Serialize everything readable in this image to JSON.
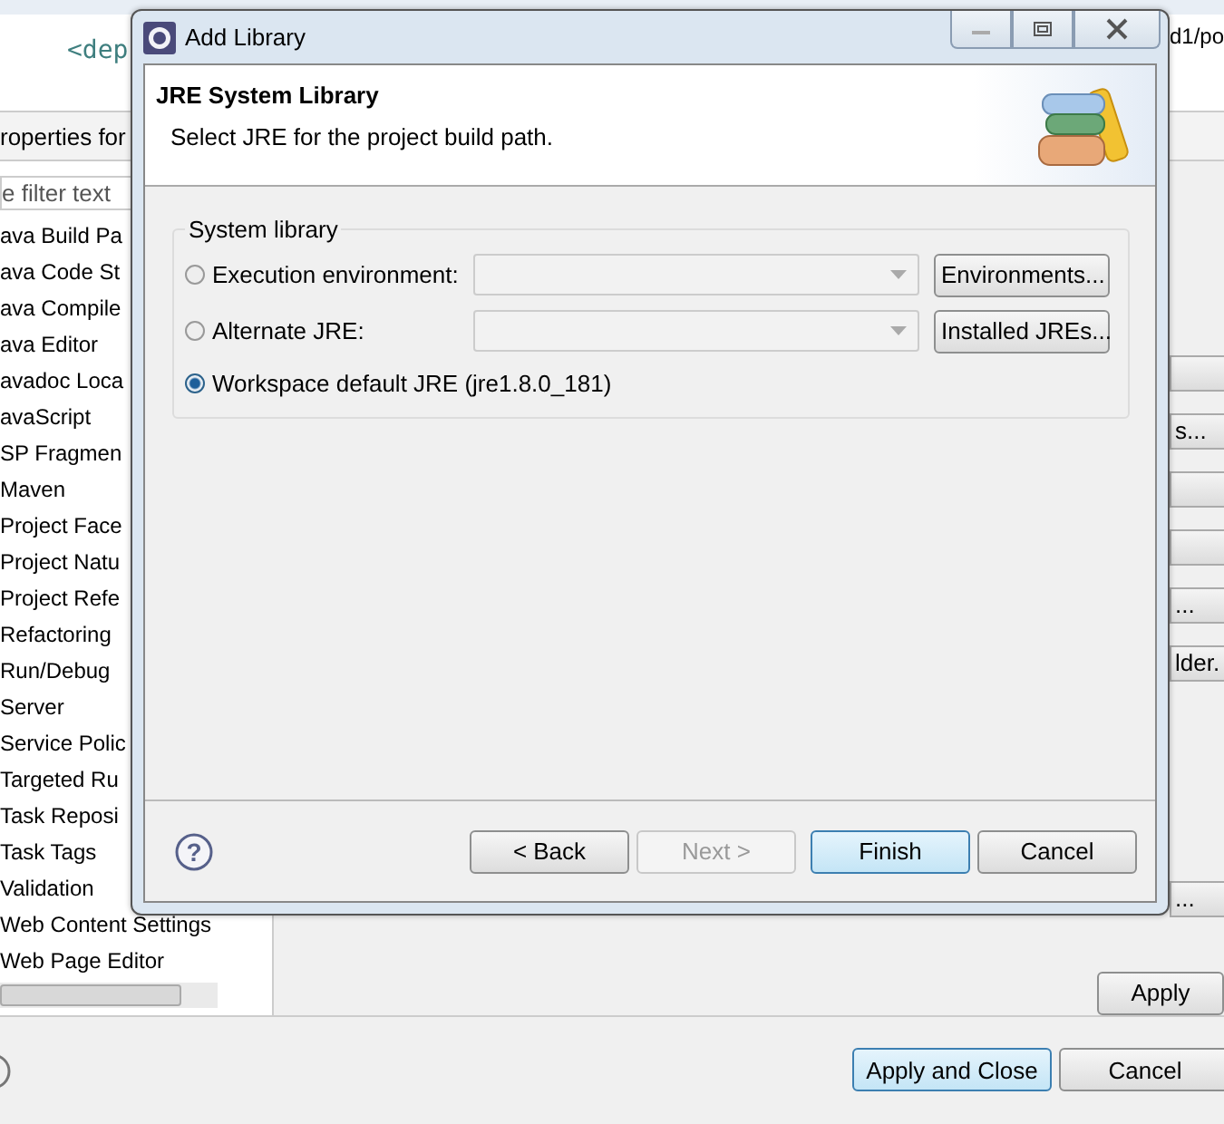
{
  "background": {
    "editor_code": "<dep",
    "editor_path": "d1/po",
    "properties_title": "roperties for",
    "filter": {
      "placeholder": "e filter text"
    },
    "tree_items": [
      "ava Build Pa",
      "ava Code St",
      "ava Compile",
      "ava Editor",
      "avadoc Loca",
      "avaScript",
      "SP Fragmen",
      "Maven",
      "Project Face",
      "Project Natu",
      "Project Refe",
      "Refactoring",
      "Run/Debug",
      "Server",
      "Service Polic",
      "Targeted Ru",
      "Task Reposi",
      "Task Tags",
      "Validation",
      "Web Content Settings",
      "Web Page Editor"
    ],
    "side_buttons": [
      {
        "kind": "blank"
      },
      {
        "kind": "text",
        "label": "s..."
      },
      {
        "kind": "blank"
      },
      {
        "kind": "blank"
      },
      {
        "kind": "text",
        "label": "..."
      },
      {
        "kind": "text",
        "label": "lder."
      },
      {
        "kind": "text",
        "label": "..."
      }
    ],
    "apply": "Apply",
    "apply_and_close": "Apply and Close",
    "cancel": "Cancel"
  },
  "dialog": {
    "title": "Add Library",
    "header_title": "JRE System Library",
    "header_subtitle": "Select JRE for the project build path.",
    "group_label": "System library",
    "help": "?",
    "options": [
      {
        "label": "Execution environment:",
        "selected": false,
        "kind": "combo",
        "button": "Environments..."
      },
      {
        "label": "Alternate JRE:",
        "selected": false,
        "kind": "combo",
        "button": "Installed JREs..."
      },
      {
        "label": "Workspace default JRE (jre1.8.0_181)",
        "selected": true,
        "kind": "plain"
      }
    ],
    "buttons": [
      {
        "label": "< Back",
        "disabled": false,
        "default": false
      },
      {
        "label": "Next >",
        "disabled": true,
        "default": false
      },
      {
        "label": "Finish",
        "disabled": false,
        "default": true
      },
      {
        "label": "Cancel",
        "disabled": false,
        "default": false
      }
    ]
  }
}
